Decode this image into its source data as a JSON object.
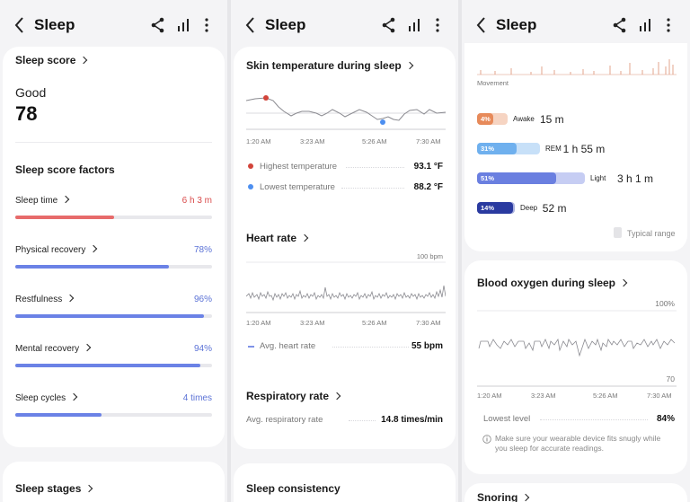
{
  "panel1": {
    "title": "Sleep",
    "score_card": {
      "heading": "Sleep score",
      "grade": "Good",
      "score": "78"
    },
    "factors_heading": "Sleep score factors",
    "factors": [
      {
        "label": "Sleep time",
        "value": "6 h 3 m",
        "fill": 0.5,
        "color": "#e76b6b",
        "value_color": "#d94b4b"
      },
      {
        "label": "Physical recovery",
        "value": "78%",
        "fill": 0.78,
        "color": "#6b82e6",
        "value_color": "#5b72d6"
      },
      {
        "label": "Restfulness",
        "value": "96%",
        "fill": 0.96,
        "color": "#6b82e6",
        "value_color": "#5b72d6"
      },
      {
        "label": "Mental recovery",
        "value": "94%",
        "fill": 0.94,
        "color": "#6b82e6",
        "value_color": "#5b72d6"
      },
      {
        "label": "Sleep cycles",
        "value": "4 times",
        "fill": 0.44,
        "color": "#6b82e6",
        "value_color": "#5b72d6"
      }
    ],
    "stages_heading": "Sleep stages"
  },
  "panel2": {
    "title": "Sleep",
    "skin": {
      "heading": "Skin temperature during sleep",
      "times": [
        "1:20 AM",
        "3:23 AM",
        "5:26 AM",
        "7:30 AM"
      ],
      "highest_label": "Highest temperature",
      "highest_value": "93.1 °F",
      "lowest_label": "Lowest temperature",
      "lowest_value": "88.2 °F",
      "high_color": "#d2443a",
      "low_color": "#4d8ff0"
    },
    "heart": {
      "heading": "Heart rate",
      "top_label": "100 bpm",
      "times": [
        "1:20 AM",
        "3:23 AM",
        "5:26 AM",
        "7:30 AM"
      ],
      "avg_label": "Avg. heart rate",
      "avg_value": "55 bpm"
    },
    "resp": {
      "heading": "Respiratory rate",
      "avg_label": "Avg. respiratory rate",
      "avg_value": "14.8 times/min"
    },
    "consistency_heading": "Sleep consistency"
  },
  "panel3": {
    "title": "Sleep",
    "movement_label": "Movement",
    "stages": [
      {
        "pct": "4%",
        "name": "Awake",
        "duration": "15 m",
        "color": "#e78a5a",
        "range": "#f6d4c2"
      },
      {
        "pct": "31%",
        "name": "REM",
        "duration": "1 h 55 m",
        "color": "#6fb0ee",
        "range": "#c7e0f8"
      },
      {
        "pct": "51%",
        "name": "Light",
        "duration": "3 h 1 m",
        "color": "#6a7fe0",
        "range": "#c6cdf3"
      },
      {
        "pct": "14%",
        "name": "Deep",
        "duration": "52 m",
        "color": "#2a3aa0",
        "range": "#aab1de"
      }
    ],
    "typical_range": "Typical range",
    "oxygen": {
      "heading": "Blood oxygen during sleep",
      "top_label": "100%",
      "bottom_label": "70",
      "times": [
        "1:20 AM",
        "3:23 AM",
        "5:26 AM",
        "7:30 AM"
      ],
      "lowest_label": "Lowest level",
      "lowest_value": "84%",
      "note": "Make sure your wearable device fits snugly while you sleep for accurate readings."
    },
    "snoring_heading": "Snoring"
  }
}
